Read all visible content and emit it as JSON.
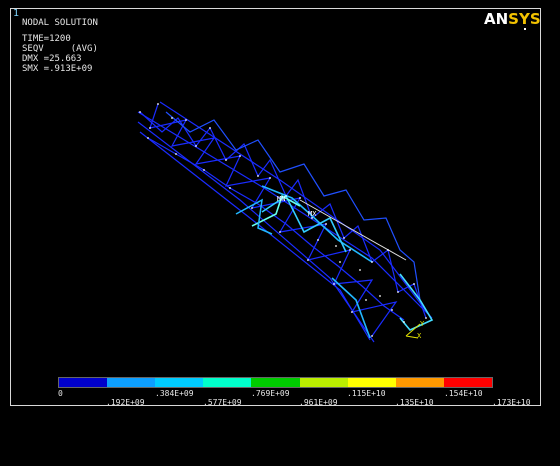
{
  "window": {
    "number": "1"
  },
  "info": {
    "title": "NODAL SOLUTION",
    "time": "TIME=1200",
    "seqv": "SEQV     (AVG)",
    "dmx": "DMX =25.663",
    "smx": "SMX =.913E+09"
  },
  "logo": {
    "part1": "AN",
    "part2": "SYS"
  },
  "markers": {
    "mn": "MN",
    "mx": "MX",
    "axis_y": "Y",
    "axis_x": "X"
  },
  "legend": {
    "colors": [
      "#0000cc",
      "#0d9fff",
      "#00ccff",
      "#00ffcc",
      "#00cc00",
      "#bbee00",
      "#ffff00",
      "#ff9900",
      "#ff0000"
    ],
    "top_labels": [
      "0",
      ".384E+09",
      ".769E+09",
      ".115E+10",
      ".154E+10"
    ],
    "bottom_labels": [
      ".192E+09",
      ".577E+09",
      ".961E+09",
      ".135E+10",
      ".173E+10"
    ]
  }
}
